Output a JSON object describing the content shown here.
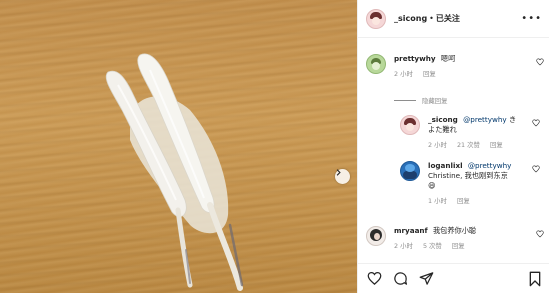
{
  "post": {
    "author": "_sicong",
    "separator": "•",
    "follow_label": "已关注",
    "more_label": "•••"
  },
  "icons": {
    "more": "more-options-icon",
    "next": "chevron-right-icon",
    "like": "heart-icon",
    "comment": "comment-bubble-icon",
    "share": "send-paper-plane-icon",
    "save": "bookmark-icon"
  },
  "comments": [
    {
      "username": "prettywhy",
      "text": "嗯呵",
      "time": "2 小时",
      "reply_label": "回复",
      "avatar": "green"
    },
    {
      "username": "mryaanf",
      "text": "我包养你小聪",
      "time": "2 小时",
      "likes": "5 次赞",
      "reply_label": "回复",
      "avatar": "dark"
    }
  ],
  "hide_replies_label": "隐藏回复",
  "replies": [
    {
      "username": "_sicong",
      "mention": "@prettywhy",
      "text_line1": "き",
      "text_line2": "よた難れ",
      "time": "2 小时",
      "likes": "21 次赞",
      "reply_label": "回复",
      "avatar": "pink"
    },
    {
      "username": "loganlixl",
      "mention": "@prettywhy",
      "text_line1": "",
      "text_line2": "Christine, 我也刚到东京",
      "emoji": "😄",
      "time": "1 小时",
      "reply_label": "回复",
      "avatar": "blue"
    }
  ],
  "colors": {
    "mention": "#00376b",
    "meta_text": "#8e8e8e",
    "wood": "#c99853"
  }
}
